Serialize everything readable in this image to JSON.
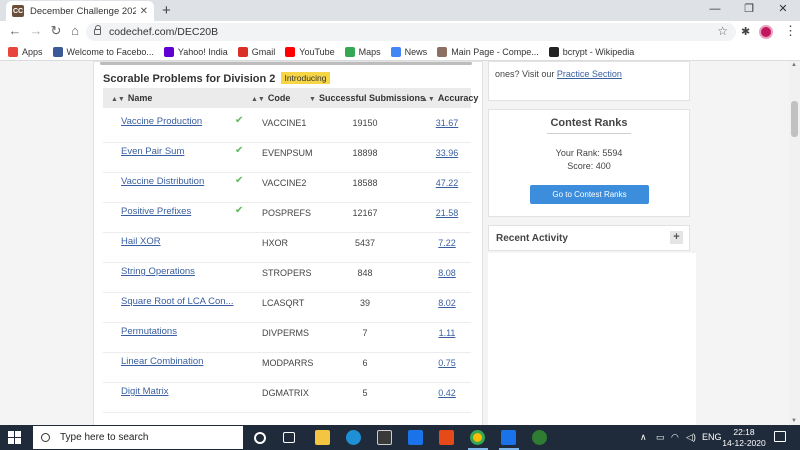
{
  "browser": {
    "tab_title": "December Challenge 2020 Divisio",
    "favicon_text": "CC",
    "new_tab": "+",
    "url": "codechef.com/DEC20B",
    "window_controls": [
      "—",
      "❐",
      "✕"
    ]
  },
  "bookmarks": [
    {
      "label": "Apps",
      "icon": "apps-grid-icon",
      "color": "#e8453c"
    },
    {
      "label": "Welcome to Facebo...",
      "icon": "facebook-icon",
      "color": "#3b5998"
    },
    {
      "label": "Yahoo! India",
      "icon": "yahoo-icon",
      "color": "#6001d2"
    },
    {
      "label": "Gmail",
      "icon": "gmail-icon",
      "color": "#d93025"
    },
    {
      "label": "YouTube",
      "icon": "youtube-icon",
      "color": "#ff0000"
    },
    {
      "label": "Maps",
      "icon": "maps-icon",
      "color": "#34a853"
    },
    {
      "label": "News",
      "icon": "news-icon",
      "color": "#4285f4"
    },
    {
      "label": "Main Page - Compe...",
      "icon": "wiki-icon",
      "color": "#8d6e63"
    },
    {
      "label": "bcrypt - Wikipedia",
      "icon": "wikipedia-w-icon",
      "color": "#222222"
    }
  ],
  "problems": {
    "heading": "Scorable Problems for Division 2",
    "badge": "Introducing",
    "columns": {
      "name": "Name",
      "code": "Code",
      "subs": "Successful Submissions",
      "accuracy": "Accuracy"
    },
    "rows": [
      {
        "name": "Vaccine Production",
        "solved": true,
        "code": "VACCINE1",
        "subs": "19150",
        "accuracy": "31.67"
      },
      {
        "name": "Even Pair Sum",
        "solved": true,
        "code": "EVENPSUM",
        "subs": "18898",
        "accuracy": "33.96"
      },
      {
        "name": "Vaccine Distribution",
        "solved": true,
        "code": "VACCINE2",
        "subs": "18588",
        "accuracy": "47.22"
      },
      {
        "name": "Positive Prefixes",
        "solved": true,
        "code": "POSPREFS",
        "subs": "12167",
        "accuracy": "21.58"
      },
      {
        "name": "Hail XOR",
        "solved": false,
        "code": "HXOR",
        "subs": "5437",
        "accuracy": "7.22"
      },
      {
        "name": "String Operations",
        "solved": false,
        "code": "STROPERS",
        "subs": "848",
        "accuracy": "8.08"
      },
      {
        "name": "Square Root of LCA Con...",
        "solved": false,
        "code": "LCASQRT",
        "subs": "39",
        "accuracy": "8.02"
      },
      {
        "name": "Permutations",
        "solved": false,
        "code": "DIVPERMS",
        "subs": "7",
        "accuracy": "1.11"
      },
      {
        "name": "Linear Combination",
        "solved": false,
        "code": "MODPARRS",
        "subs": "6",
        "accuracy": "0.75"
      },
      {
        "name": "Digit Matrix",
        "solved": false,
        "code": "DGMATRIX",
        "subs": "5",
        "accuracy": "0.42"
      }
    ]
  },
  "sidebar": {
    "practice_prefix": "ones? Visit our ",
    "practice_link": "Practice Section",
    "contest_ranks": {
      "title": "Contest Ranks",
      "your_rank": "Your Rank: 5594",
      "score": "Score: 400",
      "button": "Go to Contest Ranks"
    },
    "recent_activity": "Recent Activity",
    "expand": "+"
  },
  "taskbar": {
    "search_placeholder": "Type here to search",
    "language": "ENG",
    "time": "22:18",
    "date": "14-12-2020"
  }
}
